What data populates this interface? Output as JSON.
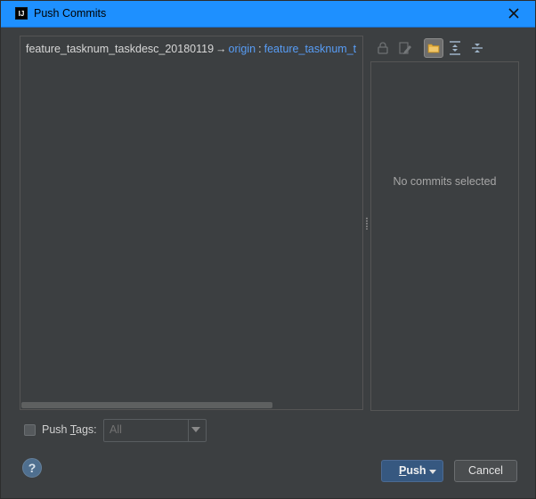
{
  "window": {
    "title": "Push Commits",
    "logo_text": "IJ"
  },
  "branch": {
    "source": "feature_tasknum_taskdesc_20180119",
    "arrow": "→",
    "remote": "origin",
    "separator": ":",
    "target": "feature_tasknum_t"
  },
  "details_panel": {
    "empty_text": "No commits selected"
  },
  "toolbar": {
    "icons": [
      "lock-icon",
      "edit-icon",
      "folder-icon",
      "expand-all-icon",
      "collapse-all-icon"
    ]
  },
  "push_tags": {
    "label_prefix": "Push ",
    "label_mnemonic": "T",
    "label_suffix": "ags:",
    "selected_value": "All"
  },
  "buttons": {
    "help": "?",
    "push_mnemonic": "P",
    "push_rest": "ush",
    "cancel": "Cancel"
  },
  "colors": {
    "titlebar": "#1e90ff",
    "background": "#3c3f41",
    "link": "#589df6",
    "push_button": "#365880"
  }
}
